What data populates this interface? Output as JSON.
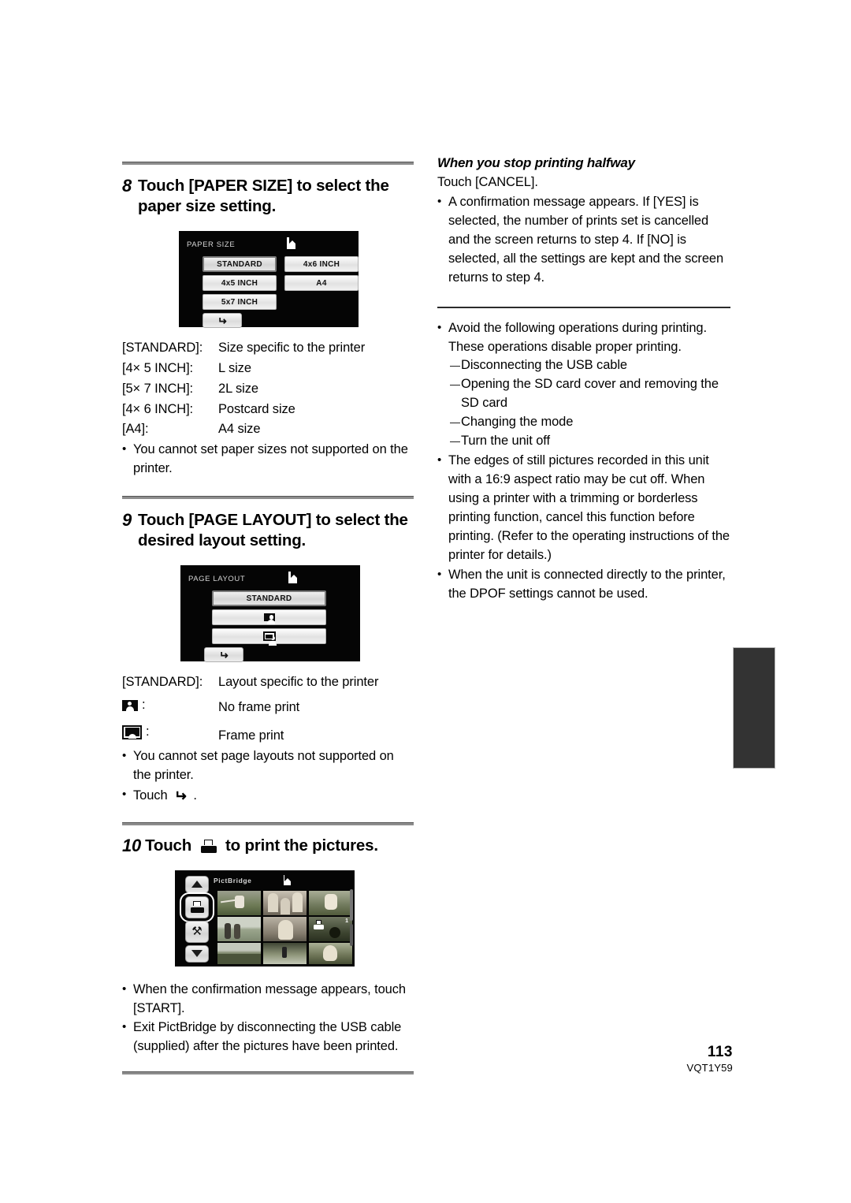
{
  "document": {
    "page_number": "113",
    "doc_id": "VQT1Y59"
  },
  "left_column": {
    "step8": {
      "number": "8",
      "title": "Touch [PAPER SIZE] to select the paper size setting.",
      "screen": {
        "title": "PAPER SIZE",
        "page_icon": "page-icon",
        "buttons": [
          {
            "label": "STANDARD",
            "selected": true
          },
          {
            "label": "4x6 INCH",
            "selected": false
          },
          {
            "label": "4x5 INCH",
            "selected": false
          },
          {
            "label": "A4",
            "selected": false
          },
          {
            "label": "5x7 INCH",
            "selected": false
          }
        ],
        "back_button": "return-arrow-icon"
      },
      "definitions": [
        {
          "term": "[STANDARD]:",
          "desc": "Size specific to the printer"
        },
        {
          "term": "[4× 5 INCH]:",
          "desc": "L size"
        },
        {
          "term": "[5× 7 INCH]:",
          "desc": "2L size"
        },
        {
          "term": "[4× 6 INCH]:",
          "desc": "Postcard size"
        },
        {
          "term": "[A4]:",
          "desc": "A4 size"
        }
      ],
      "notes": [
        "You cannot set paper sizes not supported on the printer."
      ]
    },
    "step9": {
      "number": "9",
      "title": "Touch [PAGE LAYOUT] to select the desired layout setting.",
      "screen": {
        "title": "PAGE LAYOUT",
        "page_icon": "page-icon",
        "buttons": [
          {
            "label": "STANDARD",
            "icon": "",
            "selected": true
          },
          {
            "label": "",
            "icon": "no-frame-print-icon",
            "selected": false
          },
          {
            "label": "",
            "icon": "frame-print-icon",
            "selected": false
          }
        ],
        "back_button": "return-arrow-icon"
      },
      "definitions": [
        {
          "term": "[STANDARD]:",
          "desc": "Layout specific to the printer"
        },
        {
          "term": "no-frame-print-icon",
          "term_suffix": ":",
          "desc": "No frame print"
        },
        {
          "term": "frame-print-icon",
          "term_suffix": ":",
          "desc": "Frame print"
        }
      ],
      "notes": [
        "You cannot set page layouts not supported on the printer."
      ],
      "touch_note_prefix": "Touch",
      "touch_note_icon": "return-arrow-icon",
      "touch_note_suffix": "."
    },
    "step10": {
      "number": "10",
      "title_before": "Touch",
      "title_icon": "printer-icon",
      "title_after": "to print the pictures.",
      "screen": {
        "title": "PictBridge",
        "page_icon": "page-icon",
        "print_button_icon": "printer-icon",
        "settings_button_icon": "tools-icon",
        "scroll_up_icon": "triangle-up-icon",
        "scroll_down_icon": "triangle-down-icon",
        "thumbnail_count": 9
      },
      "notes": [
        "When the confirmation message appears, touch [START].",
        "Exit PictBridge by disconnecting the USB cable (supplied) after the pictures have been printed."
      ]
    }
  },
  "right_column": {
    "section1": {
      "heading": "When you stop printing halfway",
      "line": "Touch [CANCEL].",
      "notes": [
        "A confirmation message appears. If [YES] is selected, the number of prints set is cancelled and the screen returns to step 4. If [NO] is selected, all the settings are kept and the screen returns to step 4."
      ]
    },
    "section2": {
      "notes": [
        "Avoid the following operations during printing. These operations disable proper printing.",
        "The edges of still pictures recorded in this unit with a 16:9 aspect ratio may be cut off. When using a printer with a trimming or borderless printing function, cancel this function before printing. (Refer to the operating instructions of the printer for details.)",
        "When the unit is connected directly to the printer, the DPOF settings cannot be used."
      ],
      "sub_items": [
        "Disconnecting the USB cable",
        "Opening the SD card cover and removing the SD card",
        "Changing the mode",
        "Turn the unit off"
      ]
    }
  },
  "colors": {
    "page_background": "#ffffff",
    "text": "#000000",
    "rule": "#8d8d8d",
    "lcd_background": "#050505",
    "side_tab": "#333333"
  }
}
